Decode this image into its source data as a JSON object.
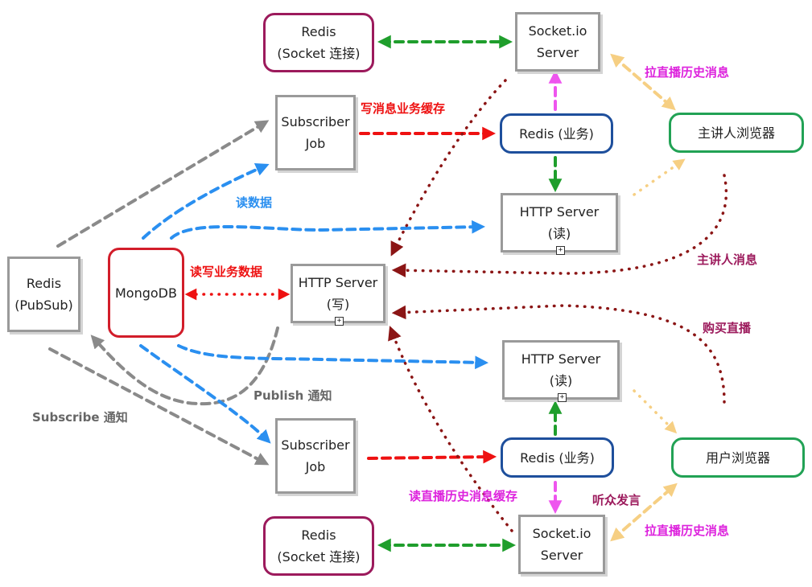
{
  "nodes": {
    "redis_socket_top": [
      "Redis",
      "(Socket 连接)"
    ],
    "socketio_top": [
      "Socket.io",
      "Server"
    ],
    "subscriber_top": [
      "Subscriber",
      "Job"
    ],
    "redis_biz_top": [
      "Redis (业务)"
    ],
    "presenter_browser": [
      "主讲人浏览器"
    ],
    "http_read_top": [
      "HTTP Server",
      "(读)"
    ],
    "redis_pubsub": [
      "Redis",
      "(PubSub)"
    ],
    "mongodb": [
      "MongoDB"
    ],
    "http_write": [
      "HTTP Server",
      "(写)"
    ],
    "http_read_bottom": [
      "HTTP Server",
      "(读)"
    ],
    "subscriber_bottom": [
      "Subscriber",
      "Job"
    ],
    "redis_biz_bottom": [
      "Redis (业务)"
    ],
    "user_browser": [
      "用户浏览器"
    ],
    "redis_socket_bottom": [
      "Redis",
      "(Socket 连接)"
    ],
    "socketio_bottom": [
      "Socket.io",
      "Server"
    ]
  },
  "labels": {
    "history_top": "拉直播历史消息",
    "write_cache": "写消息业务缓存",
    "read_data": "读数据",
    "presenter_msg": "主讲人消息",
    "rw_data": "读写业务数据",
    "buy_live": "购买直播",
    "publish": "Publish 通知",
    "subscribe": "Subscribe 通知",
    "read_history_cache": "读直播历史消息缓存",
    "audience": "听众发言",
    "history_bottom": "拉直播历史消息"
  },
  "colors": {
    "gray": "#8a8a8a",
    "green": "#1f9e2c",
    "magenta": "#ee55ee",
    "red": "#ee1111",
    "blue": "#2a8ff0",
    "maroon": "#8b1515",
    "peach": "#f6cf83",
    "label_magenta": "#dd22dd",
    "label_red": "#ee1111",
    "label_blue": "#2a8ff0",
    "label_maroon": "#9c1a5c",
    "label_gray": "#666666"
  }
}
